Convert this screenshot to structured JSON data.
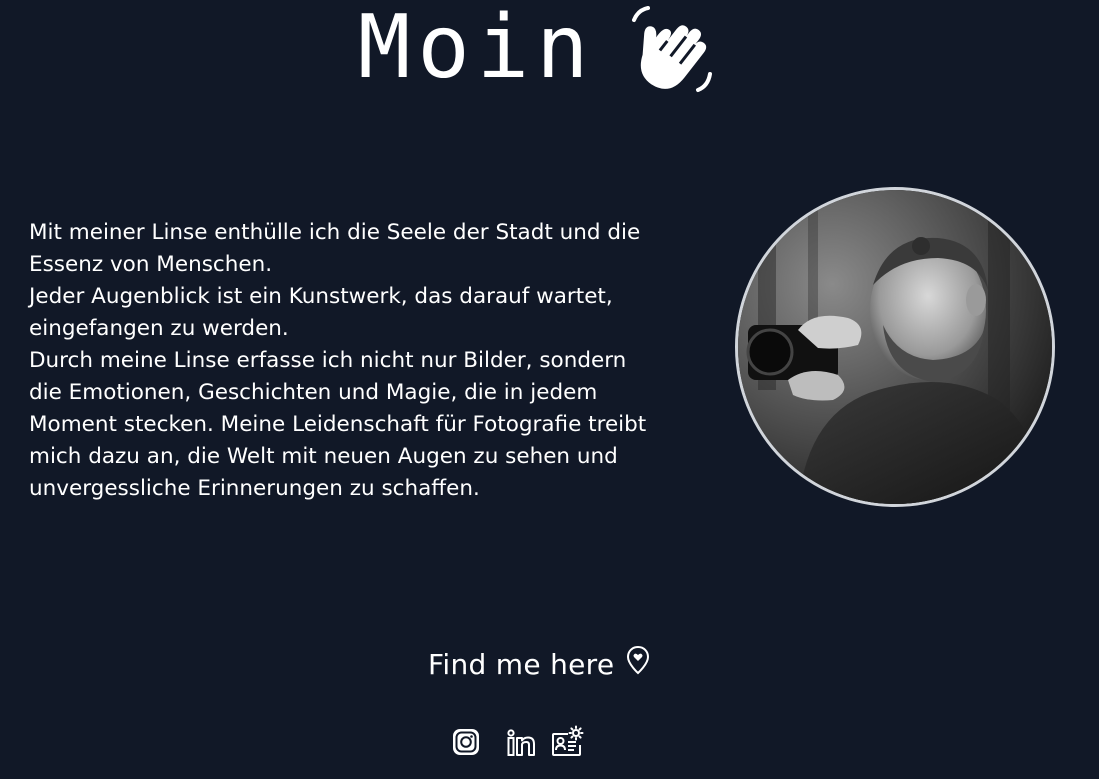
{
  "header": {
    "greeting": "Moin",
    "greeting_icon": "waving-hand-icon"
  },
  "bio": {
    "paragraphs": [
      "Mit meiner Linse enthülle ich die Seele der Stadt und die Essenz von Menschen.",
      "Jeder Augenblick ist ein Kunstwerk, das darauf wartet, eingefangen zu werden.",
      "Durch meine Linse erfasse ich nicht nur Bilder, sondern die Emotionen, Geschichten und Magie, die in jedem Moment stecken. Meine Leidenschaft für Fotografie treibt mich dazu an, die Welt mit neuen Augen zu sehen und unvergessliche Erinnerungen zu schaffen."
    ]
  },
  "portrait": {
    "description_icon": "photographer-portrait"
  },
  "find_me": {
    "label": "Find me here",
    "icon": "location-pin-heart-icon"
  },
  "social": {
    "links": [
      {
        "name": "Instagram",
        "icon": "instagram-icon"
      },
      {
        "name": "LinkedIn",
        "icon": "linkedin-icon"
      },
      {
        "name": "Contact",
        "icon": "contact-card-icon"
      }
    ]
  },
  "colors": {
    "background": "#111827",
    "text": "#ffffff",
    "portrait_border": "#d1d5db"
  }
}
